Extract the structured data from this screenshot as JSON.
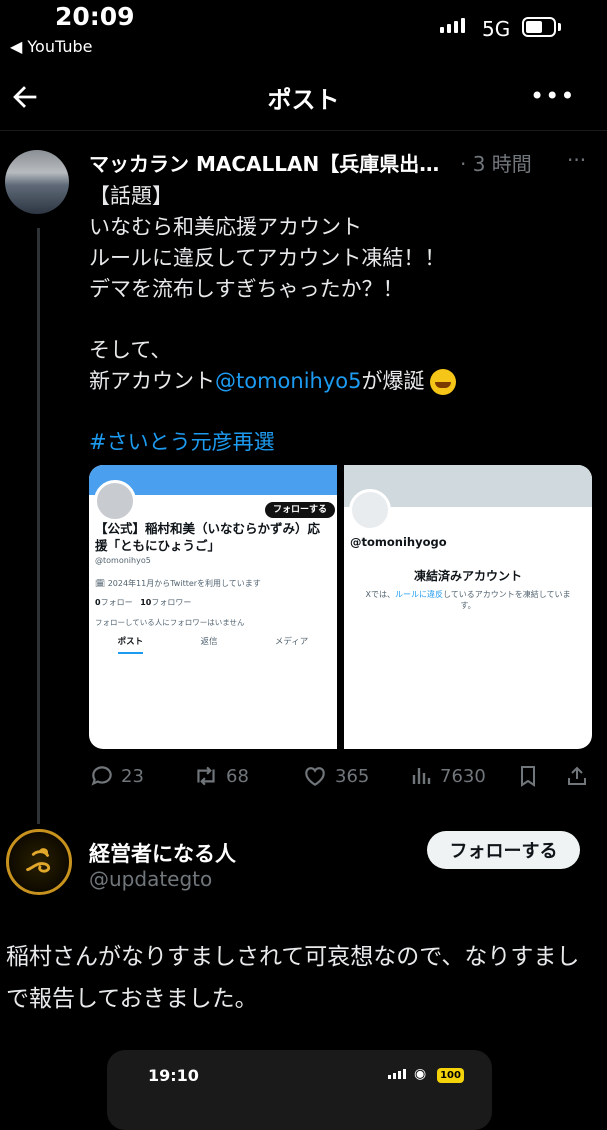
{
  "status_bar": {
    "time": "20:09",
    "back_app": "◀ YouTube",
    "network": "5G"
  },
  "header": {
    "title": "ポスト",
    "more": "•••"
  },
  "post": {
    "author": "マッカラン MACALLAN【兵庫県出…",
    "ago": "· 3 時間",
    "more": "···",
    "lines": [
      "【話題】",
      "いなむら和美応援アカウント",
      "ルールに違反してアカウント凍結！！",
      "デマを流布しすぎちゃったか？！",
      "そして、"
    ],
    "new_account_prefix": "新アカウント",
    "mention": "@tomonihyo5",
    "new_account_suffix": "が爆誕",
    "hashtag": "#さいとう元彦再選",
    "card_left": {
      "follow": "フォローする",
      "name": "【公式】稲村和美（いなむらかずみ）応援「ともにひょうご」",
      "handle": "@tomonihyo5",
      "joined": "🗓 2024年11月からTwitterを利用しています",
      "following_count": "0",
      "following_label": "フォロー",
      "followers_count": "10",
      "followers_label": "フォロワー",
      "no_followers": "フォローしている人にフォロワーはいません",
      "tabs": [
        "ポスト",
        "返信",
        "メディア"
      ]
    },
    "card_right": {
      "handle": "@tomonihyogo",
      "title": "凍結済みアカウント",
      "desc_prefix": "Xでは、",
      "desc_link": "ルールに違反",
      "desc_suffix": "しているアカウントを凍結しています。"
    },
    "actions": {
      "replies": "23",
      "reposts": "68",
      "likes": "365",
      "views": "7630"
    }
  },
  "reply": {
    "name": "経営者になる人",
    "handle": "@updategto",
    "follow": "フォローする",
    "text": "稲村さんがなりすましされて可哀想なので、なりすましで報告しておきました。",
    "embed": {
      "time": "19:10",
      "battery": "100"
    }
  },
  "colors": {
    "accent": "#1d9bf0",
    "muted": "#71767b",
    "bg": "#000000"
  }
}
